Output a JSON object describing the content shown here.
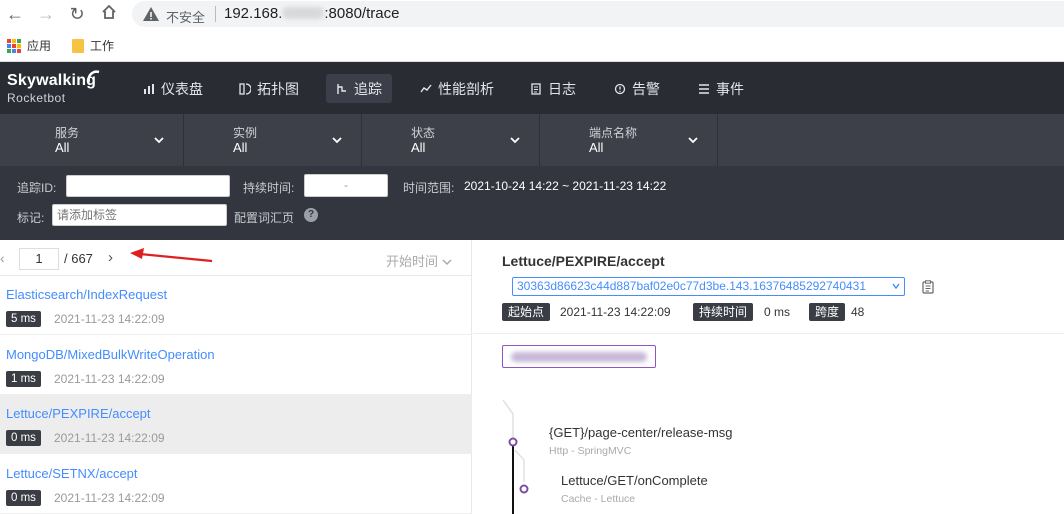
{
  "browser": {
    "insecure_label": "不安全",
    "url_prefix": "192.168.",
    "url_suffix": ":8080/trace",
    "bookmarks": [
      "应用",
      "工作"
    ]
  },
  "app": {
    "logo": "Skywalking",
    "logo_sub": "Rocketbot",
    "menu": [
      {
        "label": "仪表盘",
        "icon": "dashboard-icon"
      },
      {
        "label": "拓扑图",
        "icon": "topology-icon"
      },
      {
        "label": "追踪",
        "icon": "trace-icon",
        "active": true
      },
      {
        "label": "性能剖析",
        "icon": "profile-icon"
      },
      {
        "label": "日志",
        "icon": "log-icon"
      },
      {
        "label": "告警",
        "icon": "alarm-icon"
      },
      {
        "label": "事件",
        "icon": "event-icon"
      }
    ]
  },
  "filters": [
    {
      "label": "服务",
      "value": "All"
    },
    {
      "label": "实例",
      "value": "All"
    },
    {
      "label": "状态",
      "value": "All"
    },
    {
      "label": "端点名称",
      "value": "All"
    }
  ],
  "search": {
    "trace_id_label": "追踪ID:",
    "trace_id_value": "",
    "duration_label": "持续时间:",
    "duration_value": "-",
    "time_range_label": "时间范围:",
    "time_range_value": "2021-10-24 14:22 ~ 2021-11-23 14:22",
    "tag_label": "标记:",
    "tag_placeholder": "请添加标签",
    "config_label": "配置词汇页",
    "help": "?"
  },
  "pager": {
    "prev": "‹",
    "current": "1",
    "total": "/ 667",
    "next": "›",
    "sort": "开始时间"
  },
  "traces": [
    {
      "name": "Elasticsearch/IndexRequest",
      "duration": "5 ms",
      "time": "2021-11-23 14:22:09"
    },
    {
      "name": "MongoDB/MixedBulkWriteOperation",
      "duration": "1 ms",
      "time": "2021-11-23 14:22:09"
    },
    {
      "name": "Lettuce/PEXPIRE/accept",
      "duration": "0 ms",
      "time": "2021-11-23 14:22:09",
      "selected": true
    },
    {
      "name": "Lettuce/SETNX/accept",
      "duration": "0 ms",
      "time": "2021-11-23 14:22:09"
    }
  ],
  "detail": {
    "title": "Lettuce/PEXPIRE/accept",
    "trace_id": "30363d86623c44d887baf02e0c77d3be.143.16376485292740431",
    "start_label": "起始点",
    "start_value": "2021-11-23 14:22:09",
    "duration_label": "持续时间",
    "duration_value": "0 ms",
    "span_label": "跨度",
    "span_value": "48",
    "spans": [
      {
        "name": "{GET}/page-center/release-msg",
        "component": "Http - SpringMVC"
      },
      {
        "name": "Lettuce/GET/onComplete",
        "component": "Cache - Lettuce"
      }
    ]
  },
  "colors": {
    "link": "#448dfe",
    "header_bg": "#2a2c34",
    "filter_bg": "#3d4049",
    "badge_bg": "#3b3d45",
    "tree_purple": "#7a4ea8",
    "arrow_red": "#e02020"
  }
}
